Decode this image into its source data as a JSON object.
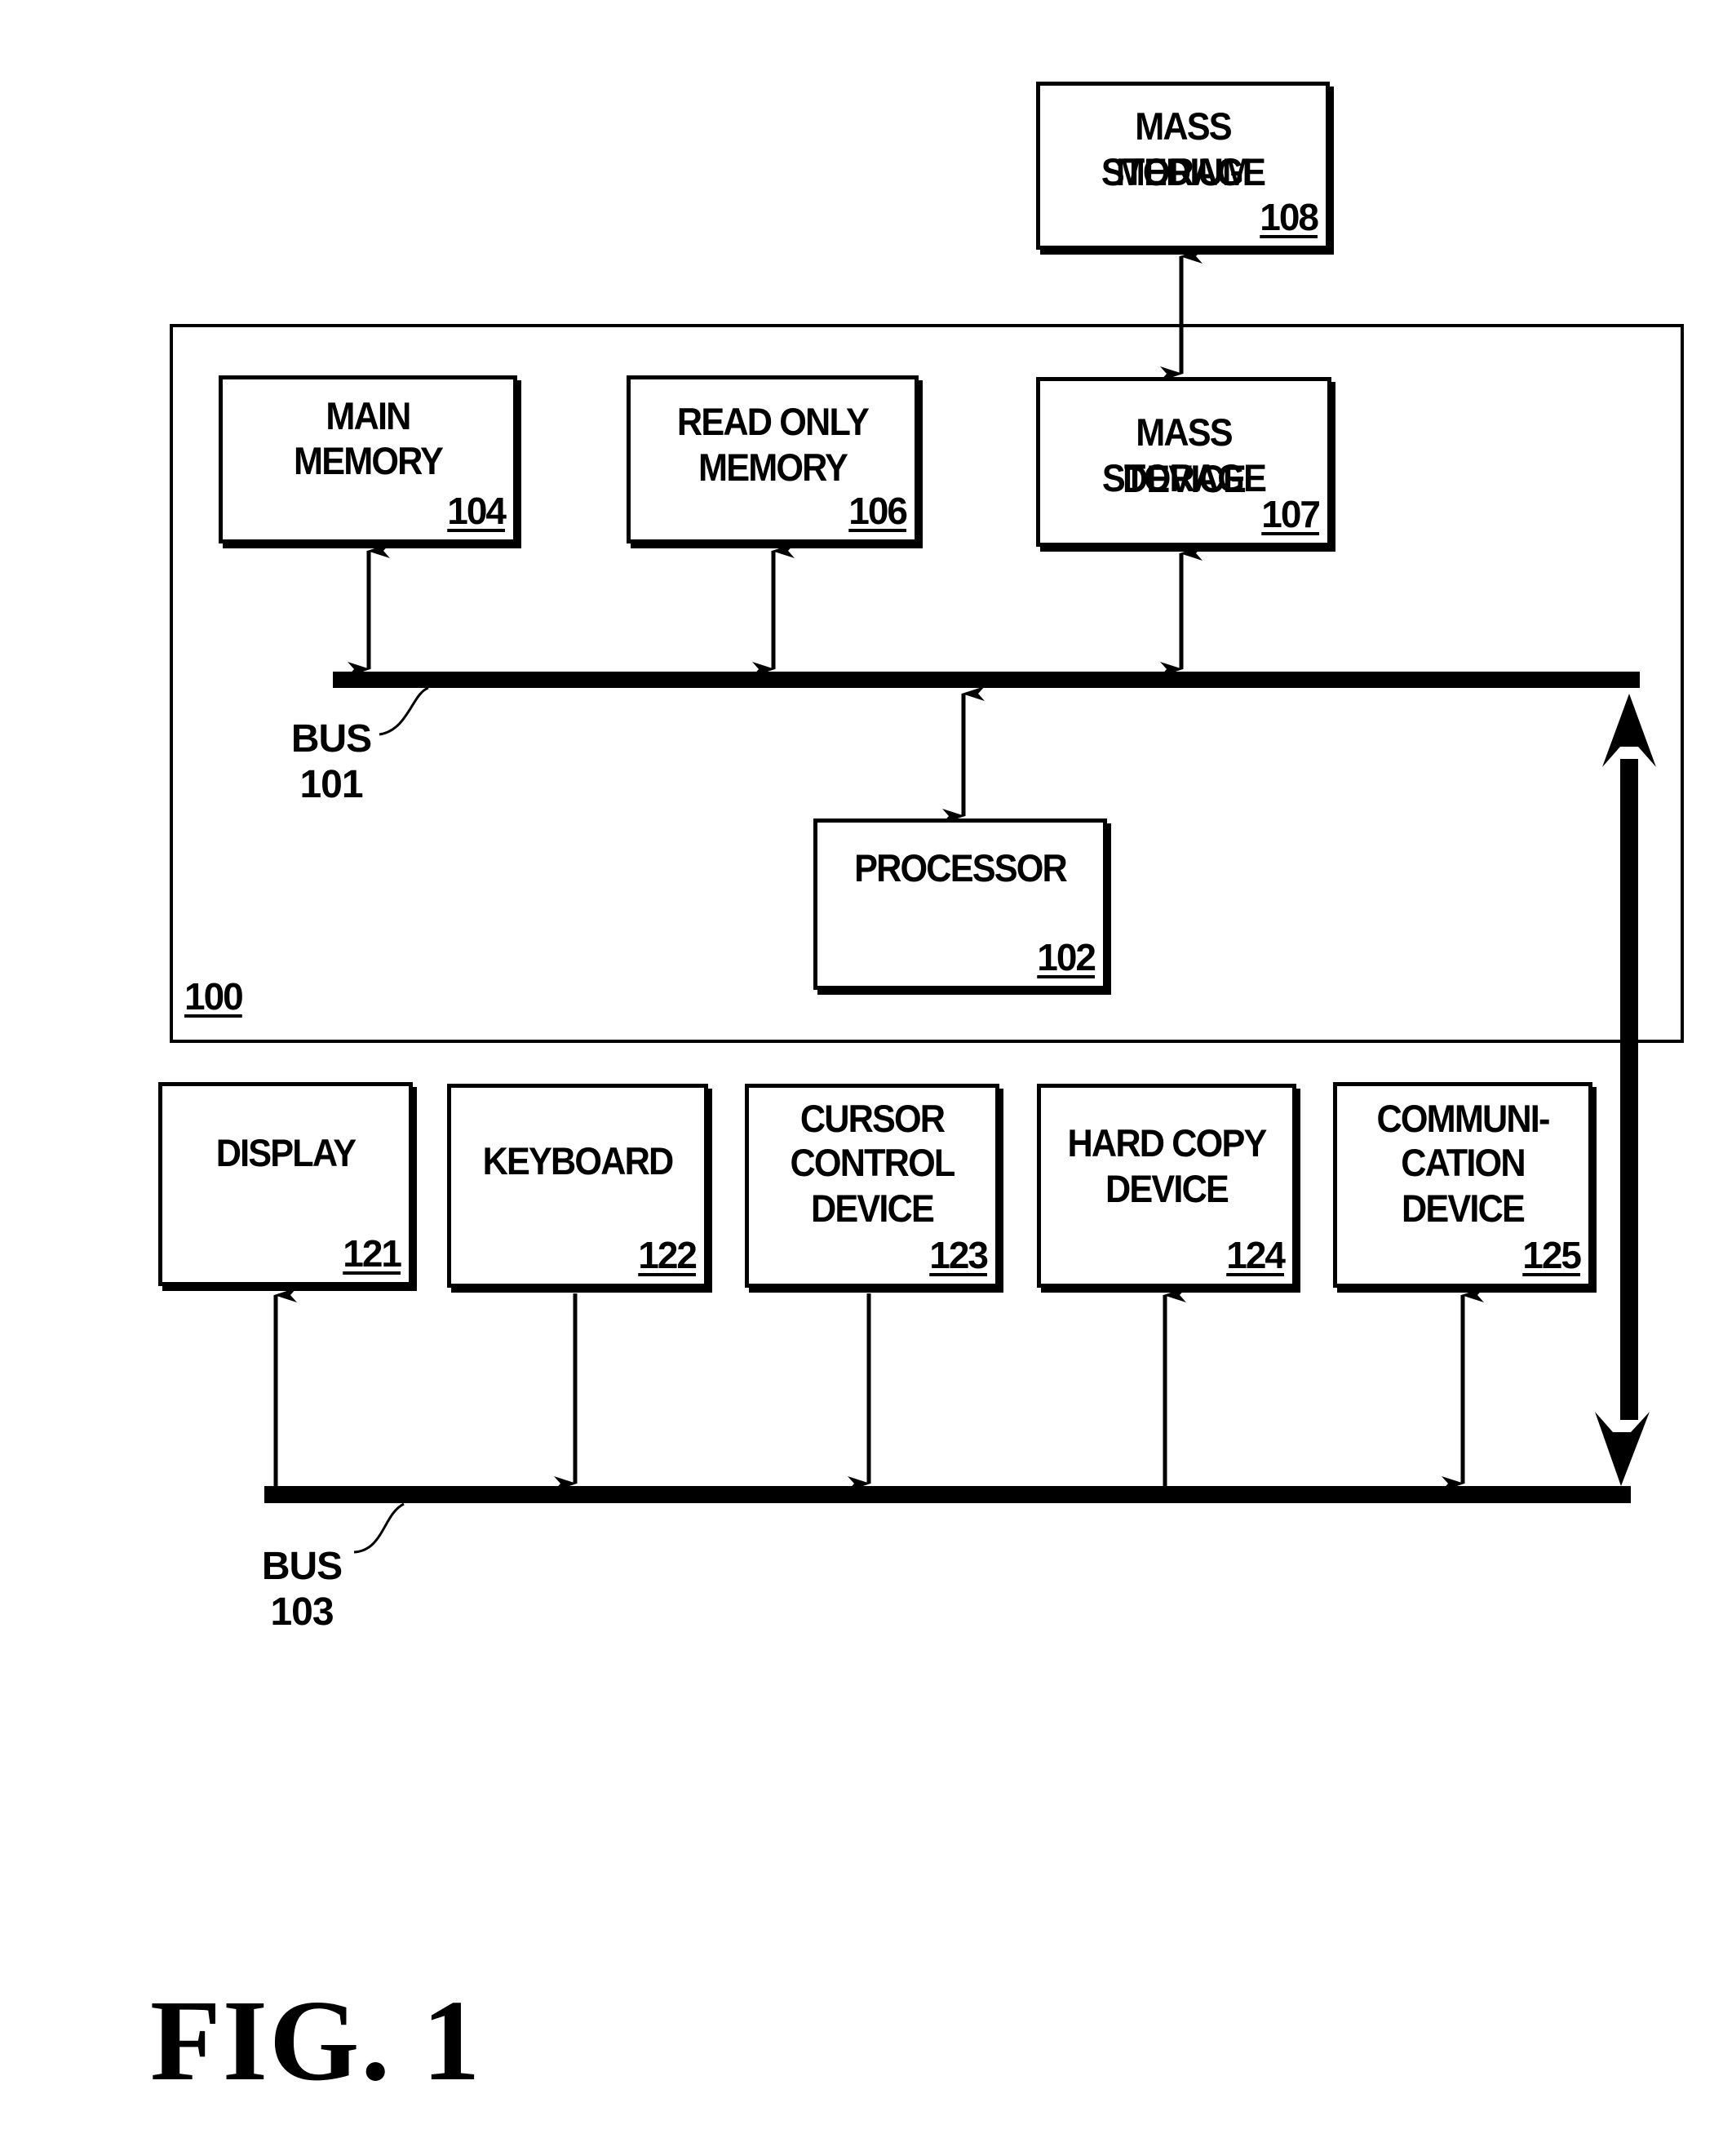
{
  "figure": {
    "caption": "FIG. 1",
    "system": {
      "ref": "100"
    },
    "components": {
      "mass_storage_medium": {
        "lines": [
          "MASS STORAGE",
          "MEDIUM"
        ],
        "ref": "108"
      },
      "main_memory": {
        "lines": [
          "MAIN",
          "MEMORY"
        ],
        "ref": "104"
      },
      "read_only_memory": {
        "lines": [
          "READ ONLY",
          "MEMORY"
        ],
        "ref": "106"
      },
      "mass_storage_device": {
        "lines": [
          "MASS STORAGE",
          "DEVICE"
        ],
        "ref": "107"
      },
      "processor": {
        "lines": [
          "PROCESSOR"
        ],
        "ref": "102"
      },
      "display": {
        "lines": [
          "DISPLAY"
        ],
        "ref": "121"
      },
      "keyboard": {
        "lines": [
          "KEYBOARD"
        ],
        "ref": "122"
      },
      "cursor_control_device": {
        "lines": [
          "CURSOR",
          "CONTROL",
          "DEVICE"
        ],
        "ref": "123"
      },
      "hard_copy_device": {
        "lines": [
          "HARD COPY",
          "DEVICE"
        ],
        "ref": "124"
      },
      "communication_device": {
        "lines": [
          "COMMUNI-",
          "CATION",
          "DEVICE"
        ],
        "ref": "125"
      }
    },
    "buses": {
      "bus_101": {
        "label": "BUS",
        "ref": "101"
      },
      "bus_103": {
        "label": "BUS",
        "ref": "103"
      }
    },
    "connections": [
      {
        "from": "mass_storage_medium",
        "to": "mass_storage_device",
        "direction": "bidirectional"
      },
      {
        "from": "main_memory",
        "to": "bus_101",
        "direction": "bidirectional"
      },
      {
        "from": "read_only_memory",
        "to": "bus_101",
        "direction": "bidirectional"
      },
      {
        "from": "mass_storage_device",
        "to": "bus_101",
        "direction": "bidirectional"
      },
      {
        "from": "bus_101",
        "to": "processor",
        "direction": "bidirectional"
      },
      {
        "from": "bus_101",
        "to": "bus_103",
        "direction": "bidirectional"
      },
      {
        "from": "bus_103",
        "to": "display",
        "direction": "to-component"
      },
      {
        "from": "keyboard",
        "to": "bus_103",
        "direction": "to-bus"
      },
      {
        "from": "cursor_control_device",
        "to": "bus_103",
        "direction": "to-bus"
      },
      {
        "from": "bus_103",
        "to": "hard_copy_device",
        "direction": "to-component"
      },
      {
        "from": "communication_device",
        "to": "bus_103",
        "direction": "bidirectional"
      }
    ]
  }
}
